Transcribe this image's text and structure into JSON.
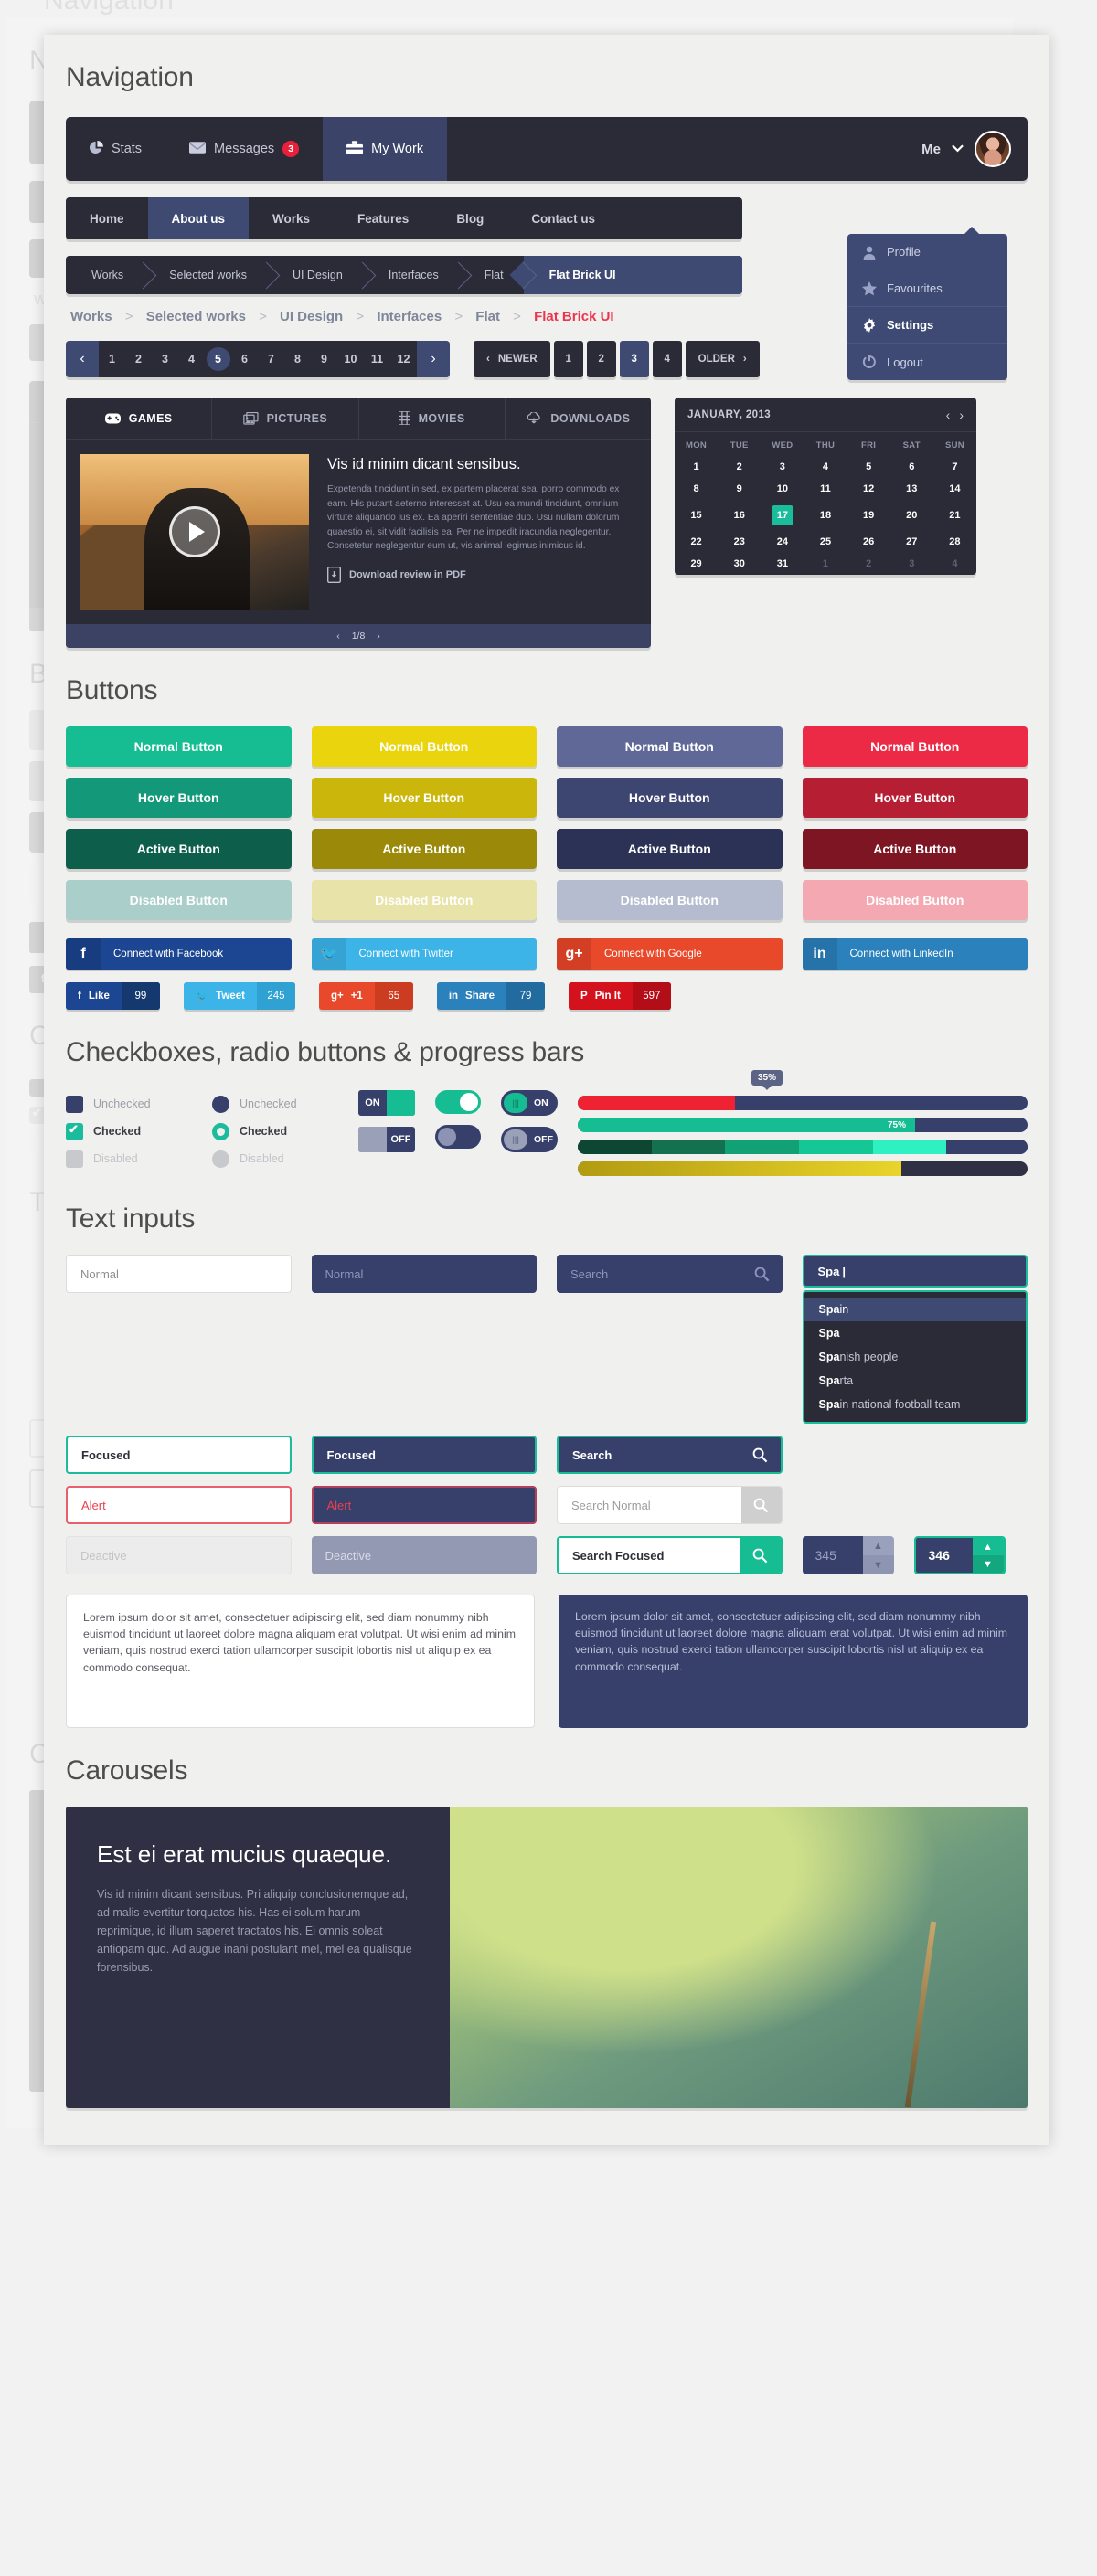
{
  "page": {
    "ghost_title": "Navigation",
    "title": "Navigation"
  },
  "topnav": {
    "items": [
      {
        "label": "Stats",
        "icon": "pie-chart-icon",
        "badge": null,
        "active": false
      },
      {
        "label": "Messages",
        "icon": "envelope-icon",
        "badge": "3",
        "active": false
      },
      {
        "label": "My Work",
        "icon": "briefcase-icon",
        "badge": null,
        "active": true
      }
    ],
    "user_label": "Me"
  },
  "dropdown": {
    "items": [
      {
        "label": "Profile",
        "icon": "user-icon",
        "active": false
      },
      {
        "label": "Favourites",
        "icon": "star-icon",
        "active": false
      },
      {
        "label": "Settings",
        "icon": "gear-icon",
        "active": true
      },
      {
        "label": "Logout",
        "icon": "power-icon",
        "active": false
      }
    ]
  },
  "subnav": {
    "items": [
      {
        "label": "Home",
        "active": false
      },
      {
        "label": "About us",
        "active": true
      },
      {
        "label": "Works",
        "active": false
      },
      {
        "label": "Features",
        "active": false
      },
      {
        "label": "Blog",
        "active": false
      },
      {
        "label": "Contact us",
        "active": false
      }
    ]
  },
  "crumbbar": {
    "items": [
      {
        "label": "Works",
        "active": false
      },
      {
        "label": "Selected works",
        "active": false
      },
      {
        "label": "UI Design",
        "active": false
      },
      {
        "label": "Interfaces",
        "active": false
      },
      {
        "label": "Flat",
        "active": false
      },
      {
        "label": "Flat Brick UI",
        "active": true
      }
    ]
  },
  "breadcrumb": {
    "items": [
      "Works",
      "Selected works",
      "UI Design",
      "Interfaces",
      "Flat",
      "Flat Brick UI"
    ],
    "separator": ">"
  },
  "pagination": {
    "prev": "‹",
    "next": "›",
    "pages": [
      "1",
      "2",
      "3",
      "4",
      "5",
      "6",
      "7",
      "8",
      "9",
      "10",
      "11",
      "12"
    ],
    "current": "5",
    "newer_label": "NEWER",
    "older_label": "OLDER",
    "small_pages": [
      "1",
      "2",
      "3",
      "4"
    ],
    "small_current": "3"
  },
  "media": {
    "tabs": [
      {
        "label": "GAMES",
        "icon": "gamepad-icon",
        "active": true
      },
      {
        "label": "PICTURES",
        "icon": "photos-icon",
        "active": false
      },
      {
        "label": "MOVIES",
        "icon": "film-icon",
        "active": false
      },
      {
        "label": "DOWNLOADS",
        "icon": "cloud-download-icon",
        "active": false
      }
    ],
    "title": "Vis id minim dicant sensibus.",
    "body": "Expetenda tincidunt in sed, ex partem placerat sea, porro commodo ex eam. His putant aeterno interesset at. Usu ea mundi tincidunt, omnium virtute aliquando ius ex. Ea aperiri sententiae duo. Usu nullam dolorum quaestio ei, sit vidit facilisis ea. Per ne impedit iracundia neglegentur. Consetetur neglegentur eum ut, vis animal legimus inimicus id.",
    "pdf_label": "Download review in PDF",
    "counter": "1/8",
    "prev": "‹",
    "next": "›"
  },
  "calendar": {
    "title": "JANUARY, 2013",
    "prev": "‹",
    "next": "›",
    "weekdays": [
      "MON",
      "TUE",
      "WED",
      "THU",
      "FRI",
      "SAT",
      "SUN"
    ],
    "weeks": [
      [
        {
          "d": "1"
        },
        {
          "d": "2"
        },
        {
          "d": "3"
        },
        {
          "d": "4"
        },
        {
          "d": "5"
        },
        {
          "d": "6"
        },
        {
          "d": "7"
        }
      ],
      [
        {
          "d": "8"
        },
        {
          "d": "9"
        },
        {
          "d": "10"
        },
        {
          "d": "11"
        },
        {
          "d": "12"
        },
        {
          "d": "13"
        },
        {
          "d": "14"
        }
      ],
      [
        {
          "d": "15"
        },
        {
          "d": "16"
        },
        {
          "d": "17",
          "sel": true
        },
        {
          "d": "18"
        },
        {
          "d": "19"
        },
        {
          "d": "20"
        },
        {
          "d": "21"
        }
      ],
      [
        {
          "d": "22"
        },
        {
          "d": "23"
        },
        {
          "d": "24"
        },
        {
          "d": "25"
        },
        {
          "d": "26"
        },
        {
          "d": "27"
        },
        {
          "d": "28"
        }
      ],
      [
        {
          "d": "29"
        },
        {
          "d": "30"
        },
        {
          "d": "31"
        },
        {
          "d": "1",
          "mute": true
        },
        {
          "d": "2",
          "mute": true
        },
        {
          "d": "3",
          "mute": true
        },
        {
          "d": "4",
          "mute": true
        }
      ]
    ],
    "selected_day": "17",
    "selected_color": "#1bbc9b"
  },
  "buttons_section": {
    "heading": "Buttons",
    "states": [
      "Normal Button",
      "Hover Button",
      "Active Button",
      "Disabled Button"
    ],
    "columns": [
      {
        "name": "teal",
        "normal": "#17bd92",
        "hover": "#13997a",
        "active": "#0d5f4c",
        "disabled": "#aacfcb"
      },
      {
        "name": "yellow",
        "normal": "#ead40d",
        "hover": "#cbb70c",
        "active": "#9b8a09",
        "disabled": "#e8e3a8"
      },
      {
        "name": "indigo",
        "normal": "#5f6896",
        "hover": "#3d4671",
        "active": "#2b3255",
        "disabled": "#b6bcd0"
      },
      {
        "name": "red",
        "normal": "#ec2a45",
        "hover": "#b61e33",
        "active": "#7d1523",
        "disabled": "#f3a8b2"
      }
    ]
  },
  "social": {
    "connect": [
      {
        "network": "Facebook",
        "label": "Connect with Facebook",
        "glyph": "f",
        "color": "#1c4691",
        "icon_color": "#173c80"
      },
      {
        "network": "Twitter",
        "label": "Connect with Twitter",
        "glyph": "🐦",
        "color": "#3cb4e8",
        "icon_color": "#35a3d4"
      },
      {
        "network": "Google",
        "label": "Connect with Google",
        "glyph": "g+",
        "color": "#e8492b",
        "icon_color": "#d33f24"
      },
      {
        "network": "LinkedIn",
        "label": "Connect with LinkedIn",
        "glyph": "in",
        "color": "#2b81bc",
        "icon_color": "#2573a9"
      }
    ],
    "counters": [
      {
        "network": "Facebook",
        "label": "Like",
        "glyph": "f",
        "count": "99",
        "color": "#1c4691",
        "count_color": "#15386f"
      },
      {
        "network": "Twitter",
        "label": "Tweet",
        "glyph": "🐦",
        "count": "245",
        "color": "#3cb4e8",
        "count_color": "#2fa1d3"
      },
      {
        "network": "Google",
        "label": "+1",
        "glyph": "g+",
        "count": "65",
        "color": "#e8492b",
        "count_color": "#cc3c21"
      },
      {
        "network": "LinkedIn",
        "label": "Share",
        "glyph": "in",
        "count": "79",
        "color": "#2b81bc",
        "count_color": "#226b9e"
      },
      {
        "network": "Pinterest",
        "label": "Pin It",
        "glyph": "P",
        "count": "597",
        "color": "#d3121e",
        "count_color": "#b30d17"
      }
    ]
  },
  "controls_section": {
    "heading": "Checkboxes, radio buttons & progress bars",
    "checkbox_labels": [
      "Unchecked",
      "Checked",
      "Disabled"
    ],
    "radio_labels": [
      "Unchecked",
      "Checked",
      "Disabled"
    ],
    "toggles": [
      {
        "style": "square",
        "state": "ON",
        "on_label": "ON"
      },
      {
        "style": "square",
        "state": "OFF",
        "off_label": "OFF"
      },
      {
        "style": "round",
        "state": "ON"
      },
      {
        "style": "round",
        "state": "OFF"
      },
      {
        "style": "pill",
        "state": "ON",
        "on_label": "ON"
      },
      {
        "style": "pill",
        "state": "OFF",
        "off_label": "OFF"
      }
    ],
    "progress": [
      {
        "percent": 35,
        "label": "35%",
        "tooltip": "35%",
        "color": "#ee2233",
        "tooltip_shown": true
      },
      {
        "percent": 75,
        "label": "75%",
        "color": "#17bd92",
        "tooltip_shown": false
      },
      {
        "percent": 82,
        "segmented": true,
        "colors": [
          "#0d4632",
          "#14714f",
          "#12a075",
          "#14c795",
          "#2ff0c0"
        ]
      },
      {
        "percent": 72,
        "label": "",
        "color": "#d9c319",
        "gradient": true
      }
    ]
  },
  "inputs_section": {
    "heading": "Text inputs",
    "light": [
      {
        "value": "Normal",
        "state": "normal"
      },
      {
        "value": "Focused",
        "state": "focused"
      },
      {
        "value": "Alert",
        "state": "alert"
      },
      {
        "value": "Deactive",
        "state": "disabled"
      }
    ],
    "dark": [
      {
        "value": "Normal",
        "state": "normal"
      },
      {
        "value": "Focused",
        "state": "focused"
      },
      {
        "value": "Alert",
        "state": "alert"
      },
      {
        "value": "Deactive",
        "state": "disabled"
      }
    ],
    "search": [
      {
        "value": "Search",
        "state": "dark-normal",
        "icon": "search-icon"
      },
      {
        "value": "Search",
        "state": "dark-focused",
        "icon": "search-icon"
      },
      {
        "value": "Search Normal",
        "state": "light-normal",
        "icon": "search-icon"
      },
      {
        "value": "Search Focused",
        "state": "light-focused",
        "icon": "search-icon"
      }
    ],
    "autocomplete": {
      "value": "Spa",
      "caret": "|",
      "suggestions": [
        {
          "match": "Spa",
          "rest": "in",
          "selected": true
        },
        {
          "match": "Spa",
          "rest": "",
          "selected": false
        },
        {
          "match": "Spa",
          "rest": "nish people",
          "selected": false
        },
        {
          "match": "Spa",
          "rest": "rta",
          "selected": false
        },
        {
          "match": "Spa",
          "rest": "in national football team",
          "selected": false
        }
      ]
    },
    "spinners": [
      {
        "value": "345",
        "state": "normal",
        "up": "▲",
        "down": "▼"
      },
      {
        "value": "346",
        "state": "focused",
        "up": "▲",
        "down": "▼"
      }
    ],
    "textarea_light": "Lorem ipsum dolor sit amet, consectetuer adipiscing elit, sed diam nonummy nibh euismod tincidunt ut laoreet dolore magna aliquam erat volutpat. Ut wisi enim ad minim veniam, quis nostrud exerci tation ullamcorper suscipit lobortis nisl ut aliquip ex ea commodo consequat.",
    "textarea_dark": "Lorem ipsum dolor sit amet, consectetuer adipiscing elit, sed diam nonummy nibh euismod tincidunt ut laoreet dolore magna aliquam erat volutpat. Ut wisi enim ad minim veniam, quis nostrud exerci tation ullamcorper suscipit lobortis nisl ut aliquip ex ea commodo consequat."
  },
  "carousel_section": {
    "heading": "Carousels",
    "title": "Est ei erat mucius quaeque.",
    "body": "Vis id minim dicant sensibus. Pri aliquip conclusionemque ad, ad malis evertitur torquatos his. Has ei solum harum reprimique, id illum saperet tractatos his. Ei omnis soleat antiopam quo. Ad augue inani postulant mel, mel ea qualisque forensibus."
  }
}
